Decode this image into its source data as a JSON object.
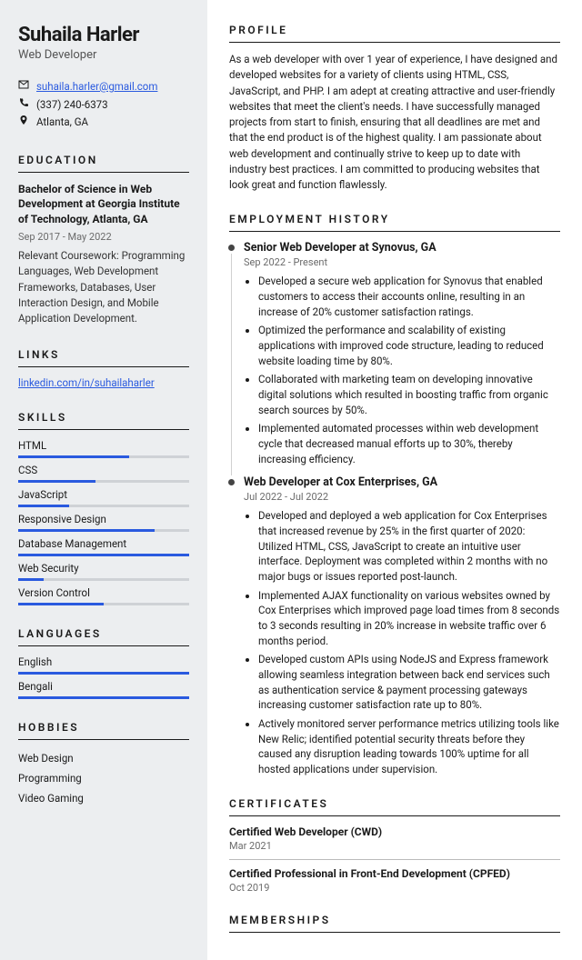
{
  "name": "Suhaila Harler",
  "role": "Web Developer",
  "contact": {
    "email": "suhaila.harler@gmail.com",
    "phone": "(337) 240-6373",
    "location": "Atlanta, GA"
  },
  "sections": {
    "education": "EDUCATION",
    "links": "LINKS",
    "skills": "SKILLS",
    "languages": "LANGUAGES",
    "hobbies": "HOBBIES",
    "profile": "PROFILE",
    "employment": "EMPLOYMENT HISTORY",
    "certificates": "CERTIFICATES",
    "memberships": "MEMBERSHIPS"
  },
  "education": {
    "degree": "Bachelor of Science in Web Development at Georgia Institute of Technology, Atlanta, GA",
    "dates": "Sep 2017 - May 2022",
    "body": "Relevant Coursework: Programming Languages, Web Development Frameworks, Databases, User Interaction Design, and Mobile Application Development."
  },
  "links": [
    {
      "label": "linkedin.com/in/suhailaharler"
    }
  ],
  "skills": [
    {
      "name": "HTML",
      "level": 65
    },
    {
      "name": "CSS",
      "level": 45
    },
    {
      "name": "JavaScript",
      "level": 30
    },
    {
      "name": "Responsive Design",
      "level": 80
    },
    {
      "name": "Database Management",
      "level": 100
    },
    {
      "name": "Web Security",
      "level": 15
    },
    {
      "name": "Version Control",
      "level": 50
    }
  ],
  "languages": [
    {
      "name": "English",
      "level": 100
    },
    {
      "name": "Bengali",
      "level": 100
    }
  ],
  "hobbies": [
    "Web Design",
    "Programming",
    "Video Gaming"
  ],
  "profile": "As a web developer with over 1 year of experience, I have designed and developed websites for a variety of clients using HTML, CSS, JavaScript, and PHP. I am adept at creating attractive and user-friendly websites that meet the client's needs. I have successfully managed projects from start to finish, ensuring that all deadlines are met and that the end product is of the highest quality. I am passionate about web development and continually strive to keep up to date with industry best practices. I am committed to producing websites that look great and function flawlessly.",
  "jobs": [
    {
      "title": "Senior Web Developer at Synovus, GA",
      "dates": "Sep 2022 - Present",
      "bullets": [
        "Developed a secure web application for Synovus that enabled customers to access their accounts online, resulting in an increase of 20% customer satisfaction ratings.",
        "Optimized the performance and scalability of existing applications with improved code structure, leading to reduced website loading time by 80%.",
        "Collaborated with marketing team on developing innovative digital solutions which resulted in boosting traffic from organic search sources by 50%.",
        "Implemented automated processes within web development cycle that decreased manual efforts up to 30%, thereby increasing efficiency."
      ]
    },
    {
      "title": "Web Developer at Cox Enterprises, GA",
      "dates": "Jul 2022 - Jul 2022",
      "bullets": [
        "Developed and deployed a web application for Cox Enterprises that increased revenue by 25% in the first quarter of 2020: Utilized HTML, CSS, JavaScript to create an intuitive user interface. Deployment was completed within 2 months with no major bugs or issues reported post-launch.",
        "Implemented AJAX functionality on various websites owned by Cox Enterprises which improved page load times from 8 seconds to 3 seconds resulting in 20% increase in website traffic over 6 months period.",
        "Developed custom APIs using NodeJS and Express framework allowing seamless integration between back end services such as authentication service & payment processing gateways increasing customer satisfaction rate up to 80%.",
        "Actively monitored server performance metrics utilizing tools like New Relic; identified potential security threats before they caused any disruption leading towards 100% uptime for all hosted applications under supervision."
      ]
    }
  ],
  "certificates": [
    {
      "title": "Certified Web Developer (CWD)",
      "date": "Mar 2021"
    },
    {
      "title": "Certified Professional in Front-End Development (CPFED)",
      "date": "Oct 2019"
    }
  ]
}
